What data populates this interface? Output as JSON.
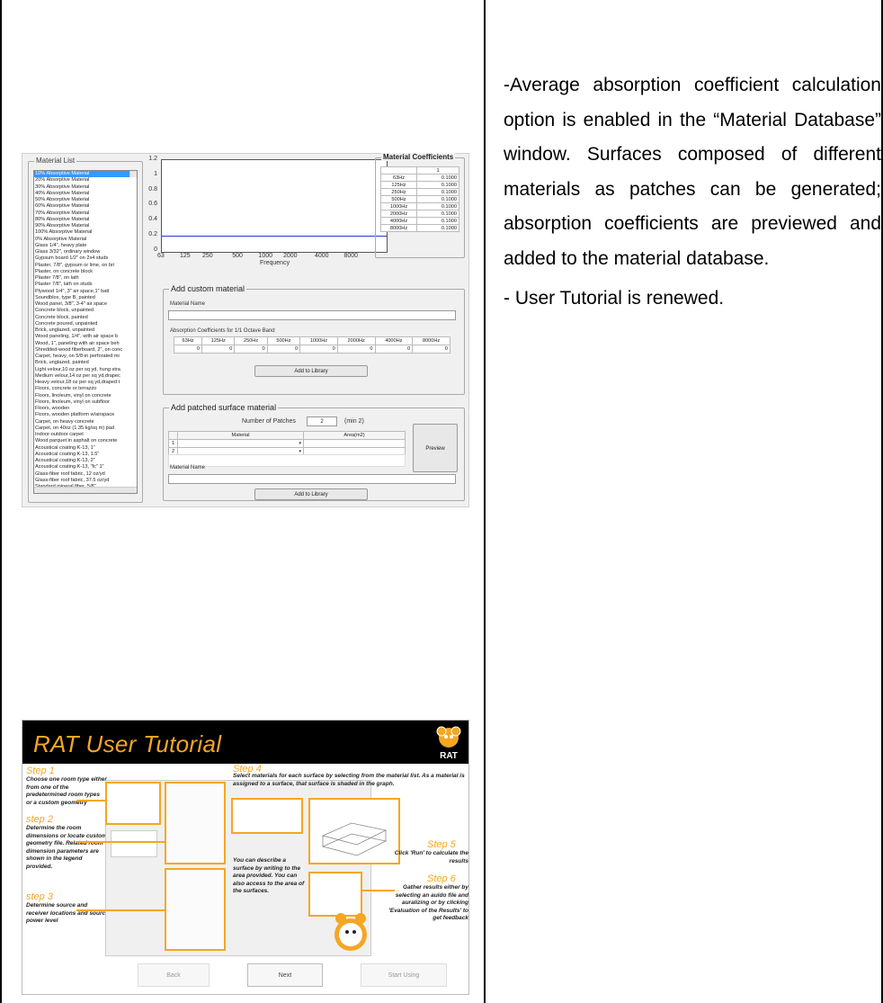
{
  "description": {
    "paragraph1": "-Average absorption coefficient calculation option is enabled in the “Material Database” window. Surfaces composed of different materials as patches can be generated; absorption coefficients are previewed and added to the material database.",
    "paragraph2": "- User Tutorial is renewed."
  },
  "material_window": {
    "list_title": "Material List",
    "materials": [
      "10% Absorptive Material",
      "20% Absorptive Material",
      "30% Absorptive Material",
      "40% Absorptive Material",
      "50% Absorptive Material",
      "60% Absorptive Material",
      "70% Absorptive Material",
      "80% Absorptive Material",
      "90% Absorptive Material",
      "100% Absorptive Material",
      "0% Absorptive Material",
      "Glass 1/4\", heavy plate",
      "Glass 3/32\", ordinary window",
      "Gypsum board 1/2\" on 2x4 studs",
      "Plaster, 7/8\", gypsum or lime, on bri",
      "Plaster, on concrete block",
      "Plaster 7/8\", on lath",
      "Plaster 7/8\", lath on studs",
      "Plywood 1/4\", 3\" air space,1\" batt",
      "Soundblox, type B, painted",
      "Wood panel, 3/8\", 3-4\" air space",
      "Concrete block, unpainted",
      "Concrete block, painted",
      "Concrete poured, unpainted",
      "Brick, unglazed, unpainted",
      "Wood paneling, 1/4\", with air space b",
      "Wood, 1\", paneling with air space beh",
      "Shredded-wood fiberboard, 2\", on conc",
      "Carpet, heavy, on 5/8-in perforated mi",
      "Brick, unglazed, painted",
      "Light velour,10 oz per sq yd, hung stra",
      "Medium velour,14 oz per sq yd,drapec",
      "Heavy velour,18 oz per sq yd,draped t",
      "Floors, concrete or terrazzo",
      "Floors, linoleum, vinyl on concrete",
      "Floors, linoleum, vinyl on subfloor",
      "Floors, wooden",
      "Floors, wooden platform w/airspace",
      "Carpet, on heavy concrete",
      "Carpet, on 40oz (1.35 kg/sq m) pad",
      "Indoor-outdoor carpet",
      "Wood parquet in asphalt on concrete",
      "Acoustical coating K-13, 1\"",
      "Acoustical coating K-13, 1.5\"",
      "Acoustical coating K-13, 2\"",
      "Acoustical coating K-13, \"fc\" 1\"",
      "Glass-fiber roof fabric, 12 oz/yd",
      "Glass-fiber roof fabric, 37.5 oz/yd",
      "Standard mineral fiber, 5/8\""
    ],
    "chart": {
      "y_ticks": [
        "1.2",
        "1",
        "0.8",
        "0.6",
        "0.4",
        "0.2",
        "0"
      ],
      "x_ticks": [
        "63",
        "125",
        "250",
        "500",
        "1000",
        "2000",
        "4000",
        "8000"
      ],
      "xlabel": "Frequency"
    },
    "coef_title": "Material Coefficients",
    "coef_col": "1",
    "coef_rows": [
      {
        "f": "63Hz",
        "v": "0.1000"
      },
      {
        "f": "125Hz",
        "v": "0.1000"
      },
      {
        "f": "250Hz",
        "v": "0.1000"
      },
      {
        "f": "500Hz",
        "v": "0.1000"
      },
      {
        "f": "1000Hz",
        "v": "0.1000"
      },
      {
        "f": "2000Hz",
        "v": "0.1000"
      },
      {
        "f": "4000Hz",
        "v": "0.1000"
      },
      {
        "f": "8000Hz",
        "v": "0.1000"
      }
    ],
    "custom_title": "Add custom material",
    "material_name_label": "Material Name",
    "absorption_label": "Absorption Coefficients for 1/1 Octave Band",
    "octave_bands": [
      "63Hz",
      "125Hz",
      "250Hz",
      "500Hz",
      "1000Hz",
      "2000Hz",
      "4000Hz",
      "8000Hz"
    ],
    "octave_values": [
      "0",
      "0",
      "0",
      "0",
      "0",
      "0",
      "0",
      "0"
    ],
    "add_library": "Add to Library",
    "patched_title": "Add patched surface material",
    "patches_label": "Number of Patches",
    "patches_value": "2",
    "patches_min": "(min 2)",
    "patch_headers": {
      "material": "Material",
      "area": "Area(m2)"
    },
    "patch_rows": [
      "1",
      "2"
    ],
    "preview": "Preview",
    "material_name_label2": "Material Name",
    "add_library2": "Add to Library"
  },
  "tutorial": {
    "title": "RAT User Tutorial",
    "logo": "RAT",
    "step1_title": "Step 1",
    "step1_text": "Choose one room type either from one of the predetermined room types or a custom geometry",
    "step2_title": "step 2",
    "step2_text": "Determine the room dimensions or locate custom geometry file. Related room dimension parameters are shown in the legend provided.",
    "step3_title": "step 3",
    "step3_text": "Determine source and receiver locations and source power level",
    "step4_title": "Step 4",
    "step4_text": "Select materials for each surface by selecting from the material list. As a material is assigned to a surface, that surface is shaded in the graph.",
    "middle_note": "You can describe a surface by writing to the area provided. You can also access to the area of the surfaces.",
    "step5_title": "Step 5",
    "step5_text": "Click 'Run' to calculate the results",
    "step6_title": "Step 6",
    "step6_text": "Gather results either by selecting an auido file and auralizing or by clicking 'Evaluation of the Results' to get feedback",
    "back": "Back",
    "next": "Next",
    "start": "Start Using"
  }
}
